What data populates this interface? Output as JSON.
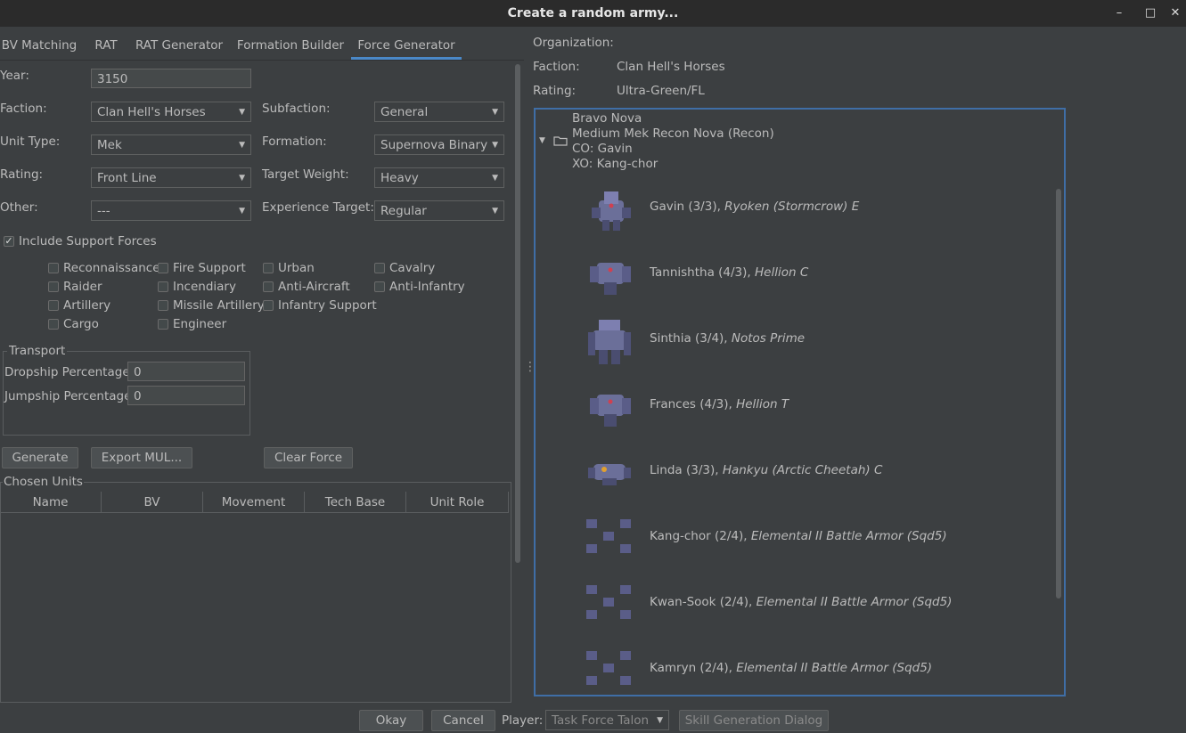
{
  "window": {
    "title": "Create a random army...",
    "minimize": "–",
    "maximize": "□",
    "close": "✕"
  },
  "tabs": [
    {
      "label": "BV Matching"
    },
    {
      "label": "RAT"
    },
    {
      "label": "RAT Generator"
    },
    {
      "label": "Formation Builder"
    },
    {
      "label": "Force Generator",
      "active": true
    }
  ],
  "form": {
    "year_label": "Year:",
    "year_value": "3150",
    "faction_label": "Faction:",
    "faction_value": "Clan Hell's Horses",
    "subfaction_label": "Subfaction:",
    "subfaction_value": "General",
    "unit_type_label": "Unit Type:",
    "unit_type_value": "Mek",
    "formation_label": "Formation:",
    "formation_value": "Supernova Binary",
    "rating_label": "Rating:",
    "rating_value": "Front Line",
    "target_weight_label": "Target Weight:",
    "target_weight_value": "Heavy",
    "other_label": "Other:",
    "other_value": "---",
    "experience_label": "Experience Target:",
    "experience_value": "Regular",
    "include_support_label": "Include Support Forces",
    "include_support_checked": true
  },
  "support_roles": [
    [
      "Reconnaissance",
      "Fire Support",
      "Urban",
      "Cavalry"
    ],
    [
      "Raider",
      "Incendiary",
      "Anti-Aircraft",
      "Anti-Infantry"
    ],
    [
      "Artillery",
      "Missile Artillery",
      "Infantry Support"
    ],
    [
      "Cargo",
      "Engineer"
    ]
  ],
  "transport": {
    "title": "Transport",
    "dropship_label": "Dropship Percentage:",
    "dropship_value": "0",
    "jumpship_label": "Jumpship Percentage:",
    "jumpship_value": "0"
  },
  "buttons": {
    "generate": "Generate",
    "export": "Export MUL...",
    "clear": "Clear Force"
  },
  "chosen_units": {
    "title": "Chosen Units",
    "columns": [
      "Name",
      "BV",
      "Movement",
      "Tech Base",
      "Unit Role"
    ]
  },
  "summary": {
    "organization_label": "Organization:",
    "faction_label": "Faction:",
    "faction_value": "Clan Hell's Horses",
    "rating_label": "Rating:",
    "rating_value": "Ultra-Green/FL"
  },
  "force_tree": {
    "node_lines": [
      "Bravo Nova",
      "Medium Mek Recon Nova (Recon)",
      "CO: Gavin",
      "XO: Kang-chor"
    ],
    "units": [
      {
        "pilot": "Gavin (3/3), ",
        "model": "Ryoken (Stormcrow) E",
        "icon": "mech-icon"
      },
      {
        "pilot": "Tannishtha (4/3), ",
        "model": "Hellion C",
        "icon": "mech-icon"
      },
      {
        "pilot": "Sinthia (3/4), ",
        "model": "Notos Prime",
        "icon": "mech-icon"
      },
      {
        "pilot": "Frances (4/3), ",
        "model": "Hellion T",
        "icon": "mech-icon"
      },
      {
        "pilot": "Linda (3/3), ",
        "model": "Hankyu (Arctic Cheetah) C",
        "icon": "mech-icon"
      },
      {
        "pilot": "Kang-chor (2/4), ",
        "model": "Elemental II Battle Armor (Sqd5)",
        "icon": "battle-armor-icon"
      },
      {
        "pilot": "Kwan-Sook (2/4), ",
        "model": "Elemental II Battle Armor (Sqd5)",
        "icon": "battle-armor-icon"
      },
      {
        "pilot": "Kamryn (2/4), ",
        "model": "Elemental II Battle Armor (Sqd5)",
        "icon": "battle-armor-icon"
      }
    ]
  },
  "bottom": {
    "okay": "Okay",
    "cancel": "Cancel",
    "player_label": "Player:",
    "player_value": "Task Force Talon",
    "skill_dialog": "Skill Generation Dialog"
  },
  "colors": {
    "accent": "#4a88c7",
    "background": "#3c3f41",
    "titlebar": "#2b2b2b"
  }
}
